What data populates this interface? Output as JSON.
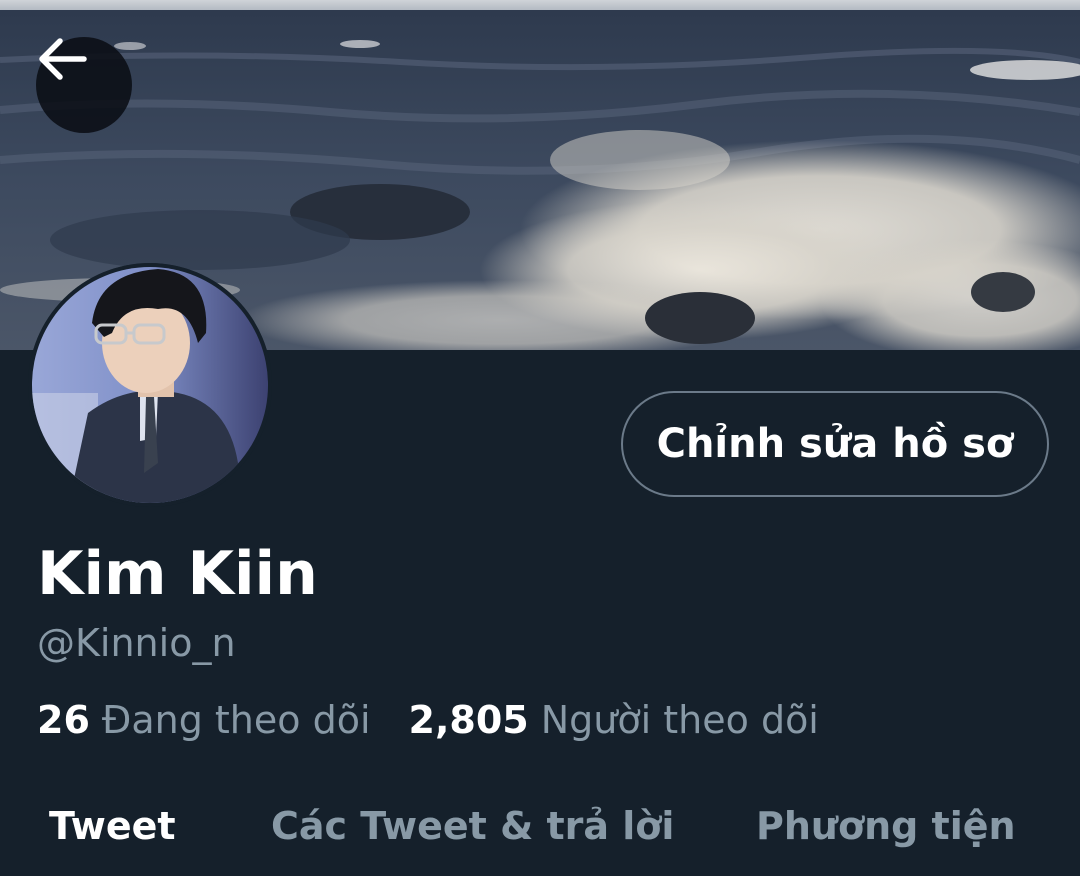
{
  "profile": {
    "display_name": "Kim Kiin",
    "handle": "@Kinnio_n",
    "edit_button_label": "Chỉnh sửa hồ sơ"
  },
  "stats": {
    "following_count": "26",
    "following_label": "Đang theo dõi",
    "followers_count": "2,805",
    "followers_label": "Người theo dõi"
  },
  "tabs": [
    {
      "label": "Tweet",
      "active": true
    },
    {
      "label": "Các Tweet & trả lời",
      "active": false
    },
    {
      "label": "Phương tiện",
      "active": false
    }
  ],
  "icons": {
    "back": "arrow-left-icon"
  },
  "colors": {
    "background": "#15202b",
    "text_primary": "#ffffff",
    "text_secondary": "#8899a6",
    "button_border": "#6b7a89"
  }
}
